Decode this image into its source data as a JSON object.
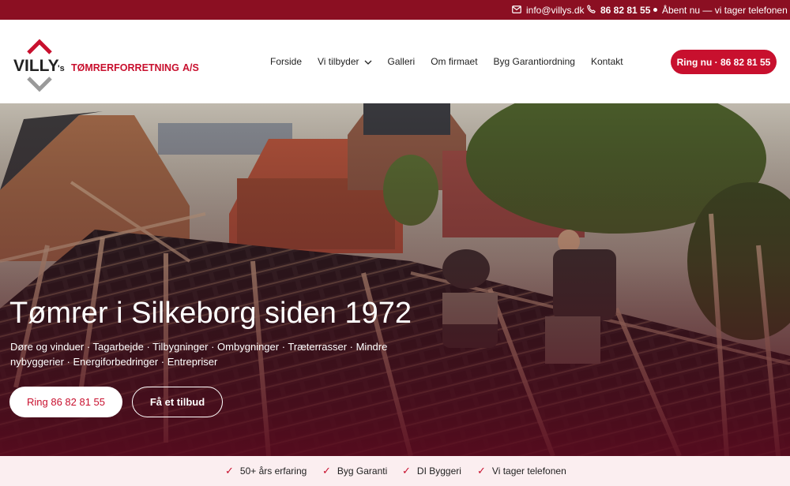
{
  "topbar": {
    "email": "info@villys.dk",
    "phone": "86 82 81 55",
    "open_status": "Åbent nu — vi tager telefonen"
  },
  "logo": {
    "brand": "VILLY",
    "suffix": "'s",
    "name_bold": "TØMRERFORRETNING",
    "name_suffix": "A/S"
  },
  "nav": {
    "items": [
      {
        "label": "Forside"
      },
      {
        "label": "Vi tilbyder",
        "dropdown": true
      },
      {
        "label": "Galleri"
      },
      {
        "label": "Om firmaet"
      },
      {
        "label": "Byg Garantiordning"
      },
      {
        "label": "Kontakt"
      }
    ]
  },
  "header_cta": "Ring nu · 86 82 81 55",
  "hero": {
    "title": "Tømrer i Silkeborg siden 1972",
    "subtitle": "Døre og vinduer · Tagarbejde · Tilbygninger · Ombygninger · Træterrasser · Mindre nybyggerier · Energiforbedringer · Entrepriser",
    "primary_button": "Ring 86 82 81 55",
    "secondary_button": "Få et tilbud"
  },
  "usp": [
    "50+ års erfaring",
    "Byg Garanti",
    "DI Byggeri",
    "Vi tager telefonen"
  ],
  "colors": {
    "topbar": "#8b0f22",
    "accent": "#c8102e",
    "usp_bg": "#fbeef0"
  }
}
